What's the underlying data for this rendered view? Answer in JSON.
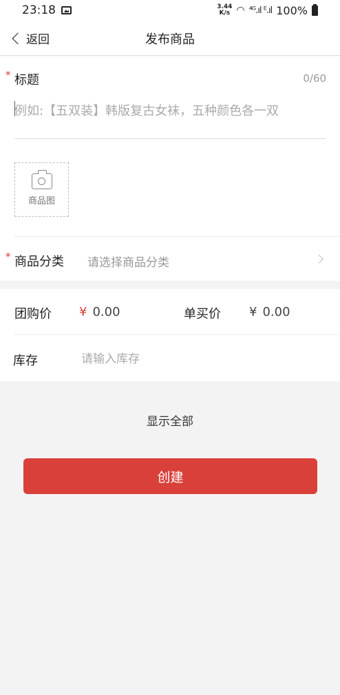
{
  "status_bar": {
    "time": "23:18",
    "net_speed_top": "3.44",
    "net_speed_bottom": "K/s",
    "signal": "⁴ᴳ.ıl ᴱ.ıl",
    "battery": "100%"
  },
  "nav": {
    "back_label": "返回",
    "title": "发布商品"
  },
  "form": {
    "title_label": "标题",
    "title_counter": "0/60",
    "title_placeholder": "例如:【五双装】韩版复古女袜，五种颜色各一双",
    "required_mark": "*",
    "photo_label": "商品图",
    "category_label": "商品分类",
    "category_placeholder": "请选择商品分类",
    "group_price_label": "团购价",
    "group_price_currency": "¥",
    "group_price_value": "0.00",
    "single_price_label": "单买价",
    "single_price_currency": "¥",
    "single_price_value": "0.00",
    "stock_label": "库存",
    "stock_placeholder": "请输入库存"
  },
  "actions": {
    "show_all": "显示全部",
    "create": "创建"
  },
  "colors": {
    "accent": "#d9403a",
    "background": "#f3f3f3"
  }
}
